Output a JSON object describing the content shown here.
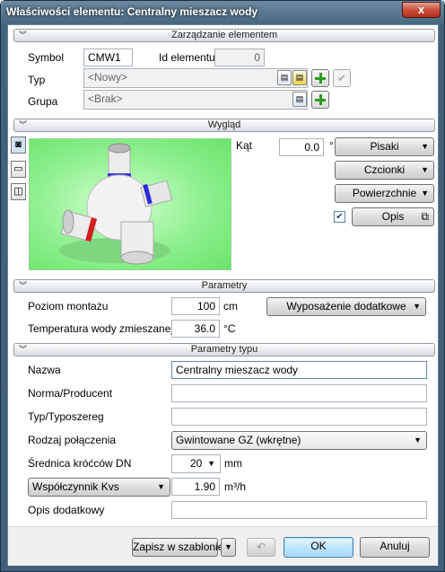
{
  "window": {
    "title": "Właściwości elementu: Centralny mieszacz wody",
    "close": "x"
  },
  "sections": {
    "zarzadzanie": "Zarządzanie elementem",
    "wyglad": "Wygląd",
    "parametry": "Parametry",
    "parametry_typu": "Parametry typu"
  },
  "zarzadzanie": {
    "symbol_label": "Symbol",
    "symbol_value": "CMW1",
    "id_label": "Id elementu",
    "id_value": "0",
    "typ_label": "Typ",
    "typ_value": "<Nowy>",
    "grupa_label": "Grupa",
    "grupa_value": "<Brak>"
  },
  "wyglad": {
    "kat_label": "Kąt",
    "kat_value": "0.0",
    "kat_unit": "°",
    "pisaki": "Pisaki",
    "czcionki": "Czcionki",
    "powierzchnie": "Powierzchnie",
    "opis": "Opis",
    "opis_checked": true
  },
  "parametry": {
    "poziom_label": "Poziom montażu",
    "poziom_value": "100",
    "poziom_unit": "cm",
    "temp_label": "Temperatura wody zmieszanej",
    "temp_value": "36.0",
    "temp_unit": "°C",
    "wyposazenie": "Wyposażenie dodatkowe"
  },
  "typ": {
    "nazwa_label": "Nazwa",
    "nazwa_value": "Centralny mieszacz wody",
    "norma_label": "Norma/Producent",
    "norma_value": "",
    "typosz_label": "Typ/Typoszereg",
    "typosz_value": "",
    "rodzaj_label": "Rodzaj połączenia",
    "rodzaj_value": "Gwintowane GZ (wkrętne)",
    "srednica_label": "Średnica króćców DN",
    "srednica_value": "20",
    "srednica_unit": "mm",
    "kvs_label": "Współczynnik Kvs",
    "kvs_value": "1.90",
    "kvs_unit": "m³/h",
    "opis_label": "Opis dodatkowy",
    "opis_value": ""
  },
  "footer": {
    "zapisz": "Zapisz w szablonie",
    "ok": "OK",
    "anuluj": "Anuluj"
  },
  "colors": {
    "accent": "#3c7fb1",
    "preview_bg": "#8ef08e"
  }
}
